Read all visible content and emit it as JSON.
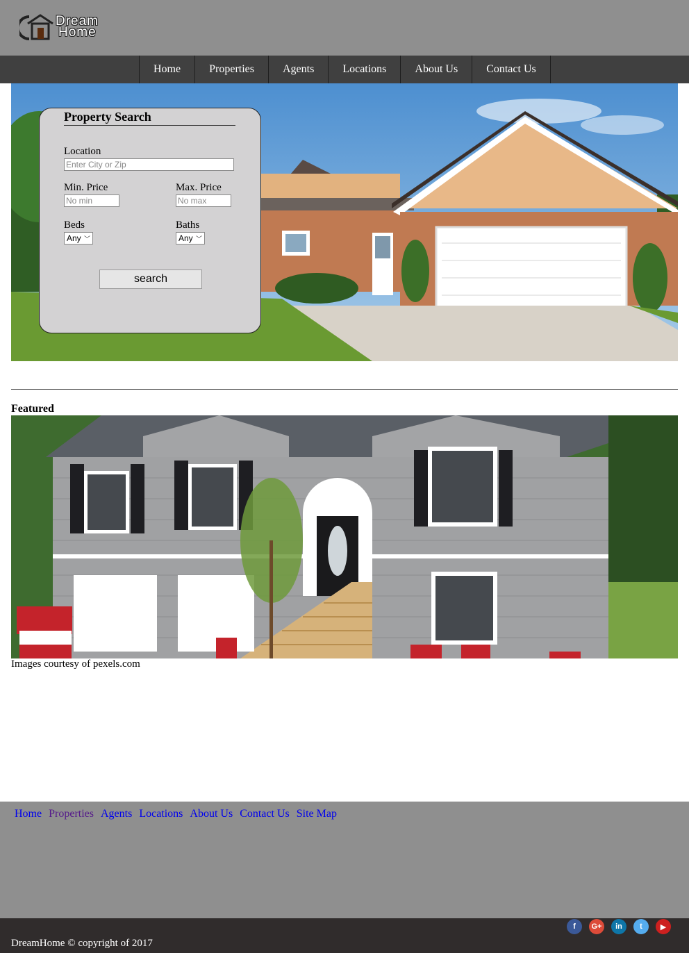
{
  "logo": {
    "line1": "Dream",
    "line2": "Home"
  },
  "nav": [
    "Home",
    "Properties",
    "Agents",
    "Locations",
    "About Us",
    "Contact Us"
  ],
  "search": {
    "title": "Property Search",
    "location_label": "Location",
    "location_placeholder": "Enter City or Zip",
    "min_label": "Min. Price",
    "min_placeholder": "No min",
    "max_label": "Max. Price",
    "max_placeholder": "No max",
    "beds_label": "Beds",
    "beds_value": "Any",
    "baths_label": "Baths",
    "baths_value": "Any",
    "button": "search"
  },
  "featured": {
    "label": "Featured",
    "credit": "Images courtesy of pexels.com"
  },
  "footer": {
    "links": [
      "Home",
      "Properties",
      "Agents",
      "Locations",
      "About Us",
      "Contact Us",
      "Site Map"
    ],
    "copyright": "DreamHome © copyright of 2017",
    "social": [
      {
        "name": "facebook-icon",
        "glyph": "f",
        "color": "#3b5998"
      },
      {
        "name": "google-plus-icon",
        "glyph": "G+",
        "color": "#dd4b39"
      },
      {
        "name": "linkedin-icon",
        "glyph": "in",
        "color": "#0e76a8"
      },
      {
        "name": "twitter-icon",
        "glyph": "t",
        "color": "#55acee"
      },
      {
        "name": "youtube-icon",
        "glyph": "▶",
        "color": "#cd201f"
      }
    ]
  }
}
